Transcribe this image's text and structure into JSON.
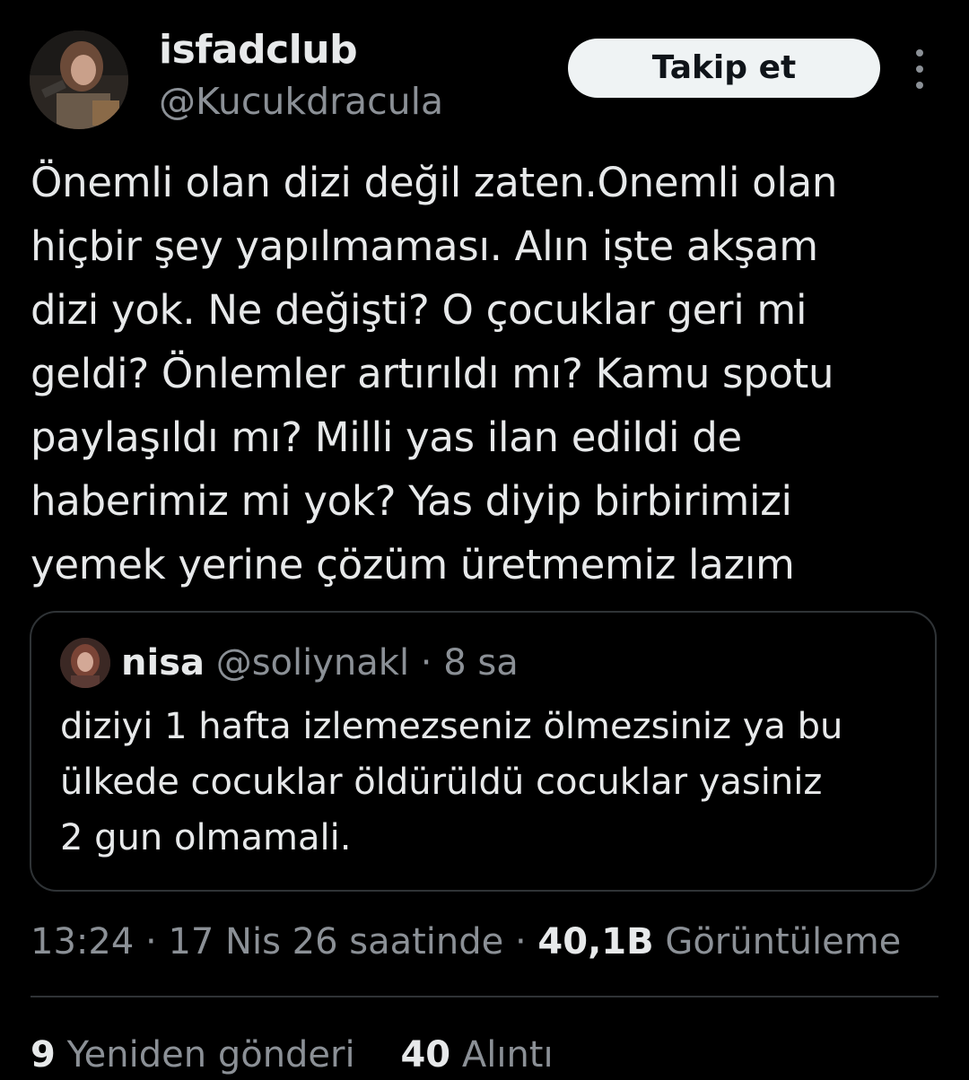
{
  "author": {
    "display_name": "isfadclub",
    "handle": "@Kucukdracula",
    "avatar_icon": "profile-photo-avatar"
  },
  "follow_button": {
    "label": "Takip et"
  },
  "more_button": {
    "icon": "more-vertical-icon"
  },
  "tweet": {
    "lines": [
      "Önemli olan dizi değil zaten.Onemli olan",
      "hiçbir şey yapılmaması. Alın işte akşam",
      "dizi yok. Ne değişti? O çocuklar geri mi",
      "geldi? Önlemler artırıldı mı? Kamu spotu",
      "paylaşıldı mı? Milli yas ilan edildi de",
      "haberimiz mi yok? Yas diyip birbirimizi",
      "yemek yerine çözüm üretmemiz lazım"
    ]
  },
  "quote": {
    "name": "nisa",
    "handle": "@soliynakl",
    "separator": "·",
    "time": "8 sa",
    "lines": [
      "diziyi 1 hafta izlemezseniz ölmezsiniz ya bu",
      "ülkede cocuklar öldürüldü cocuklar yasiniz",
      "2 gun olmamali."
    ]
  },
  "meta": {
    "time": "13:24",
    "separator": "·",
    "date": "17 Nis 26 saatinde",
    "views_count": "40,1B",
    "views_label": "Görüntüleme"
  },
  "stats": {
    "reposts_count": "9",
    "reposts_label": "Yeniden gönderi",
    "likes_count": "40",
    "likes_label": "Alıntı"
  },
  "colors": {
    "background": "#000000",
    "primary_text": "#e7e9ea",
    "secondary_text": "#8b9096",
    "border": "#2f3336",
    "follow_button_bg": "#eff3f4"
  }
}
